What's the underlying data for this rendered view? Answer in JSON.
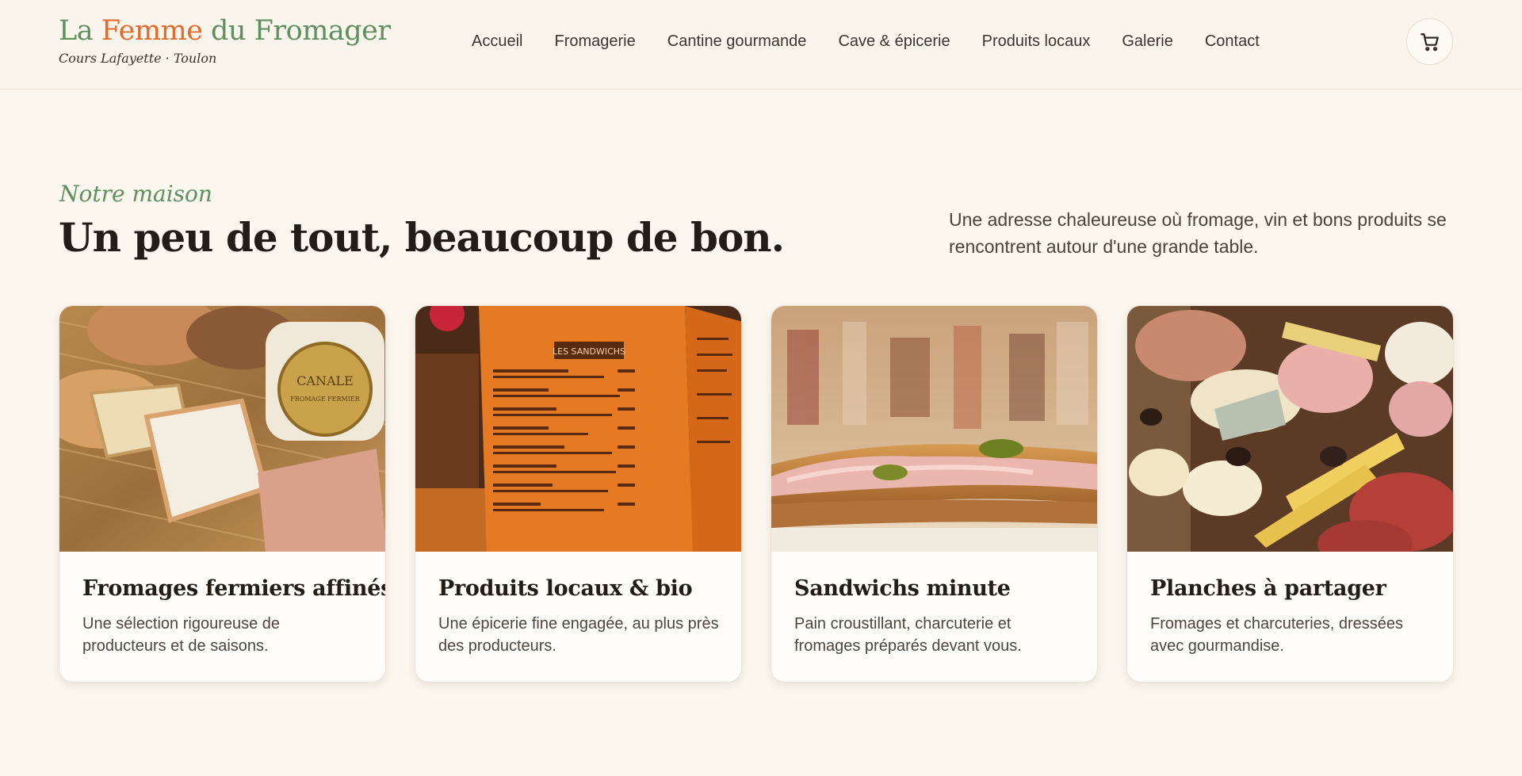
{
  "brand": {
    "title_part1": "La ",
    "title_accent": "Femme",
    "title_part2": " du Fromager",
    "subtitle": "Cours Lafayette · Toulon"
  },
  "nav": {
    "items": [
      "Accueil",
      "Fromagerie",
      "Cantine gourmande",
      "Cave & épicerie",
      "Produits locaux",
      "Galerie",
      "Contact"
    ]
  },
  "cart": {
    "icon": "cart-icon"
  },
  "intro": {
    "kicker": "Notre maison",
    "headline": "Un peu de tout, beaucoup de bon.",
    "text": "Une adresse chaleureuse où fromage, vin et bons produits se rencontrent autour d'une grande table."
  },
  "cards": [
    {
      "title": "Fromages fermiers affinés",
      "desc": "Une sélection rigoureuse de producteurs et de saisons.",
      "image": "cheese-selection-photo"
    },
    {
      "title": "Produits locaux & bio",
      "desc": "Une épicerie fine engagée, au plus près des producteurs.",
      "image": "sandwich-menu-photo"
    },
    {
      "title": "Sandwichs minute",
      "desc": "Pain croustillant, charcuterie et fromages préparés devant vous.",
      "image": "baguette-sandwich-photo"
    },
    {
      "title": "Planches à partager",
      "desc": "Fromages et charcuteries, dressées avec gourmandise.",
      "image": "sharing-board-photo"
    }
  ],
  "images": {
    "cheese_label_1": "CANALE",
    "cheese_label_2": "FROMAGE FERMIER",
    "menu_heading": "LES SANDWICHS"
  },
  "colors": {
    "background": "#fbf6ee",
    "brand_green": "#5d8f5f",
    "brand_orange": "#e26b2c"
  }
}
